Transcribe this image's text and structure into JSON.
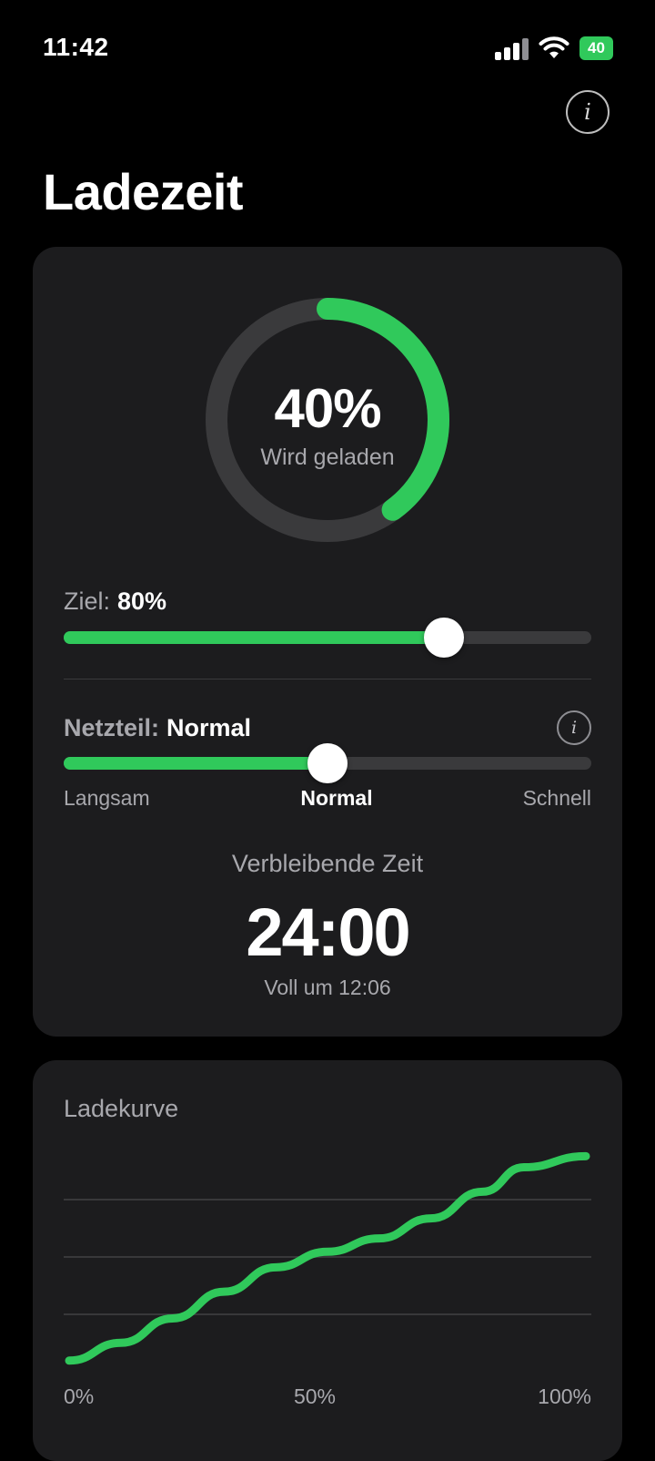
{
  "status": {
    "time": "11:42",
    "battery": "40"
  },
  "icons": {
    "info": "i"
  },
  "page_title": "Ladezeit",
  "charge": {
    "percent_text": "40%",
    "percent": 40,
    "state": "Wird geladen"
  },
  "target": {
    "label": "Ziel:",
    "value_text": "80%",
    "value": 80
  },
  "power": {
    "label": "Netzteil:",
    "value_text": "Normal",
    "slider_fraction": 0.5,
    "min_label": "Langsam",
    "mid_label": "Normal",
    "max_label": "Schnell"
  },
  "remaining": {
    "label": "Verbleibende Zeit",
    "time": "24:00",
    "full_at": "Voll um 12:06"
  },
  "colors": {
    "accent": "#30c95b",
    "card": "#1c1c1e",
    "track": "#3a3a3c"
  },
  "chart_data": {
    "type": "line",
    "title": "Ladekurve",
    "x_tick_labels": [
      "0%",
      "50%",
      "100%"
    ],
    "x": [
      0,
      0.1,
      0.2,
      0.3,
      0.4,
      0.5,
      0.6,
      0.7,
      0.8,
      0.88,
      1.0
    ],
    "y": [
      0.05,
      0.13,
      0.24,
      0.36,
      0.47,
      0.54,
      0.6,
      0.69,
      0.81,
      0.92,
      0.97
    ],
    "xlim": [
      0,
      1
    ],
    "ylim": [
      0,
      1
    ],
    "gridlines": 3,
    "grid": true
  }
}
